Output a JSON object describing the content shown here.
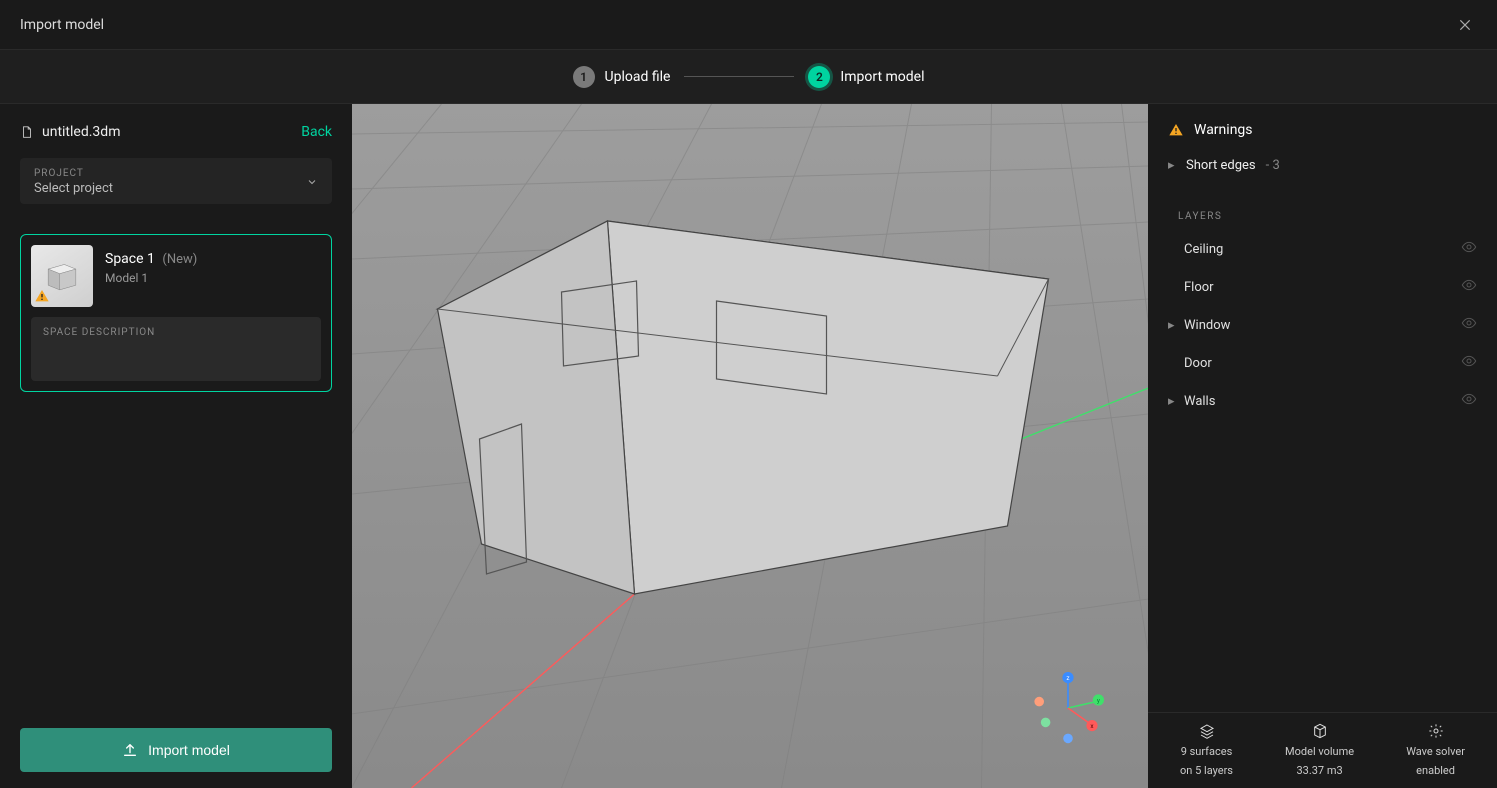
{
  "header": {
    "title": "Import model"
  },
  "stepper": {
    "step1": {
      "num": "1",
      "label": "Upload file"
    },
    "step2": {
      "num": "2",
      "label": "Import model"
    }
  },
  "left": {
    "filename": "untitled.3dm",
    "back": "Back",
    "project_select": {
      "kicker": "PROJECT",
      "value": "Select project"
    },
    "space": {
      "title": "Space 1",
      "new_tag": "(New)",
      "subtitle": "Model 1",
      "desc_kicker": "SPACE DESCRIPTION"
    },
    "import_button": "Import model"
  },
  "right": {
    "warnings_title": "Warnings",
    "warnings": [
      {
        "name": "Short edges",
        "count": "3"
      }
    ],
    "layers_title": "LAYERS",
    "layers": [
      {
        "name": "Ceiling",
        "expandable": false
      },
      {
        "name": "Floor",
        "expandable": false
      },
      {
        "name": "Window",
        "expandable": true
      },
      {
        "name": "Door",
        "expandable": false
      },
      {
        "name": "Walls",
        "expandable": true
      }
    ],
    "footer": {
      "surfaces_line1": "9 surfaces",
      "surfaces_line2": "on 5 layers",
      "volume_line1": "Model volume",
      "volume_line2": "33.37 m3",
      "solver_line1": "Wave solver",
      "solver_line2": "enabled"
    }
  }
}
